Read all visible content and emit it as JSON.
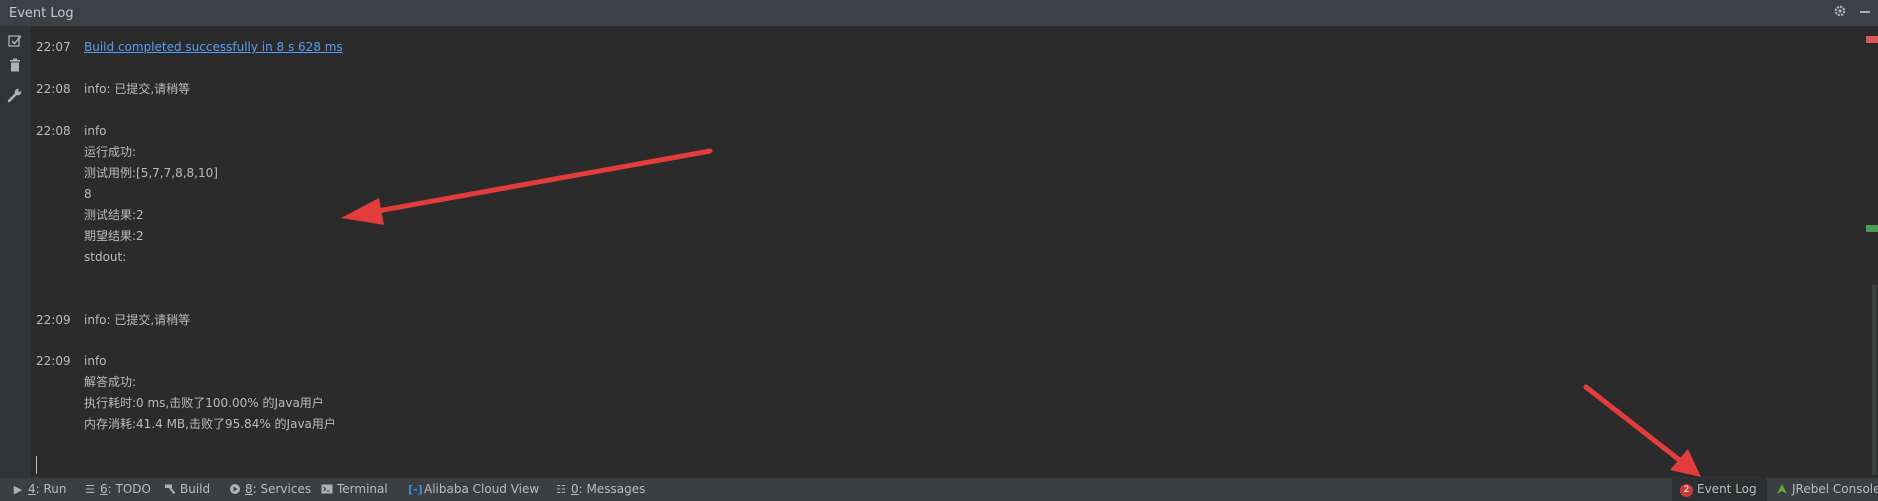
{
  "window": {
    "title": "Event Log"
  },
  "header": {
    "settings_icon": "gear-icon",
    "minimize_icon": "minimize-icon"
  },
  "toolbar": {
    "items": [
      {
        "icon": "mark-all-read-icon"
      },
      {
        "icon": "trash-icon"
      },
      {
        "icon": "wrench-icon"
      }
    ]
  },
  "log": {
    "entries": [
      {
        "time": "22:07",
        "lines": [
          "Build completed successfully in 8 s 628 ms"
        ],
        "is_link": true
      },
      {
        "time": "22:08",
        "lines": [
          "info: 已提交,请稍等"
        ]
      },
      {
        "time": "22:08",
        "lines": [
          "info",
          "运行成功:",
          "测试用例:[5,7,7,8,8,10]",
          "8",
          "测试结果:2",
          "期望结果:2",
          "stdout:"
        ]
      },
      {
        "time": "22:09",
        "lines": [
          "info: 已提交,请稍等"
        ]
      },
      {
        "time": "22:09",
        "lines": [
          "info",
          "解答成功:",
          "执行耗时:0 ms,击败了100.00% 的Java用户",
          "内存消耗:41.4 MB,击败了95.84% 的Java用户"
        ]
      }
    ]
  },
  "scrollbar_markers": [
    {
      "kind": "error",
      "color": "#e05555"
    },
    {
      "kind": "ok",
      "color": "#499c54"
    }
  ],
  "statusbar": {
    "left": [
      {
        "icon": "play-icon",
        "mnemonic": "4",
        "label": ": Run"
      },
      {
        "icon": "list-icon",
        "mnemonic": "6",
        "label": ": TODO"
      },
      {
        "icon": "hammer-icon",
        "label": "Build"
      },
      {
        "icon": "services-icon",
        "mnemonic": "8",
        "label": ": Services"
      },
      {
        "icon": "terminal-icon",
        "label": "Terminal"
      },
      {
        "icon": "cloud-brackets-icon",
        "label": "Alibaba Cloud View"
      },
      {
        "icon": "messages-icon",
        "mnemonic": "0",
        "label": ": Messages"
      }
    ],
    "right": [
      {
        "icon": "event-log-icon",
        "badge": "2",
        "label": "Event Log",
        "active": true
      },
      {
        "icon": "jrebel-icon",
        "label": "JRebel Console"
      }
    ]
  },
  "colors": {
    "background": "#2b2b2b",
    "header": "#3c4148",
    "link": "#589df6",
    "annotation_arrow": "#e33c3c"
  }
}
